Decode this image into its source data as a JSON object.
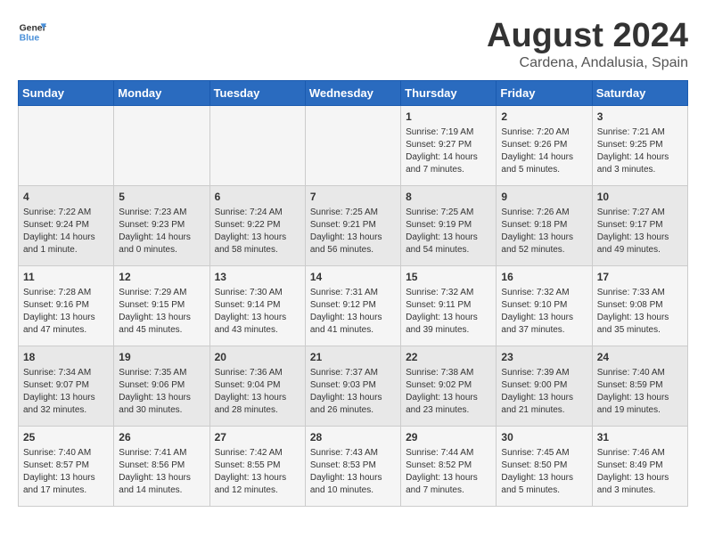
{
  "logo": {
    "line1": "General",
    "line2": "Blue"
  },
  "title": "August 2024",
  "subtitle": "Cardena, Andalusia, Spain",
  "weekdays": [
    "Sunday",
    "Monday",
    "Tuesday",
    "Wednesday",
    "Thursday",
    "Friday",
    "Saturday"
  ],
  "weeks": [
    [
      {
        "day": "",
        "info": ""
      },
      {
        "day": "",
        "info": ""
      },
      {
        "day": "",
        "info": ""
      },
      {
        "day": "",
        "info": ""
      },
      {
        "day": "1",
        "info": "Sunrise: 7:19 AM\nSunset: 9:27 PM\nDaylight: 14 hours\nand 7 minutes."
      },
      {
        "day": "2",
        "info": "Sunrise: 7:20 AM\nSunset: 9:26 PM\nDaylight: 14 hours\nand 5 minutes."
      },
      {
        "day": "3",
        "info": "Sunrise: 7:21 AM\nSunset: 9:25 PM\nDaylight: 14 hours\nand 3 minutes."
      }
    ],
    [
      {
        "day": "4",
        "info": "Sunrise: 7:22 AM\nSunset: 9:24 PM\nDaylight: 14 hours\nand 1 minute."
      },
      {
        "day": "5",
        "info": "Sunrise: 7:23 AM\nSunset: 9:23 PM\nDaylight: 14 hours\nand 0 minutes."
      },
      {
        "day": "6",
        "info": "Sunrise: 7:24 AM\nSunset: 9:22 PM\nDaylight: 13 hours\nand 58 minutes."
      },
      {
        "day": "7",
        "info": "Sunrise: 7:25 AM\nSunset: 9:21 PM\nDaylight: 13 hours\nand 56 minutes."
      },
      {
        "day": "8",
        "info": "Sunrise: 7:25 AM\nSunset: 9:19 PM\nDaylight: 13 hours\nand 54 minutes."
      },
      {
        "day": "9",
        "info": "Sunrise: 7:26 AM\nSunset: 9:18 PM\nDaylight: 13 hours\nand 52 minutes."
      },
      {
        "day": "10",
        "info": "Sunrise: 7:27 AM\nSunset: 9:17 PM\nDaylight: 13 hours\nand 49 minutes."
      }
    ],
    [
      {
        "day": "11",
        "info": "Sunrise: 7:28 AM\nSunset: 9:16 PM\nDaylight: 13 hours\nand 47 minutes."
      },
      {
        "day": "12",
        "info": "Sunrise: 7:29 AM\nSunset: 9:15 PM\nDaylight: 13 hours\nand 45 minutes."
      },
      {
        "day": "13",
        "info": "Sunrise: 7:30 AM\nSunset: 9:14 PM\nDaylight: 13 hours\nand 43 minutes."
      },
      {
        "day": "14",
        "info": "Sunrise: 7:31 AM\nSunset: 9:12 PM\nDaylight: 13 hours\nand 41 minutes."
      },
      {
        "day": "15",
        "info": "Sunrise: 7:32 AM\nSunset: 9:11 PM\nDaylight: 13 hours\nand 39 minutes."
      },
      {
        "day": "16",
        "info": "Sunrise: 7:32 AM\nSunset: 9:10 PM\nDaylight: 13 hours\nand 37 minutes."
      },
      {
        "day": "17",
        "info": "Sunrise: 7:33 AM\nSunset: 9:08 PM\nDaylight: 13 hours\nand 35 minutes."
      }
    ],
    [
      {
        "day": "18",
        "info": "Sunrise: 7:34 AM\nSunset: 9:07 PM\nDaylight: 13 hours\nand 32 minutes."
      },
      {
        "day": "19",
        "info": "Sunrise: 7:35 AM\nSunset: 9:06 PM\nDaylight: 13 hours\nand 30 minutes."
      },
      {
        "day": "20",
        "info": "Sunrise: 7:36 AM\nSunset: 9:04 PM\nDaylight: 13 hours\nand 28 minutes."
      },
      {
        "day": "21",
        "info": "Sunrise: 7:37 AM\nSunset: 9:03 PM\nDaylight: 13 hours\nand 26 minutes."
      },
      {
        "day": "22",
        "info": "Sunrise: 7:38 AM\nSunset: 9:02 PM\nDaylight: 13 hours\nand 23 minutes."
      },
      {
        "day": "23",
        "info": "Sunrise: 7:39 AM\nSunset: 9:00 PM\nDaylight: 13 hours\nand 21 minutes."
      },
      {
        "day": "24",
        "info": "Sunrise: 7:40 AM\nSunset: 8:59 PM\nDaylight: 13 hours\nand 19 minutes."
      }
    ],
    [
      {
        "day": "25",
        "info": "Sunrise: 7:40 AM\nSunset: 8:57 PM\nDaylight: 13 hours\nand 17 minutes."
      },
      {
        "day": "26",
        "info": "Sunrise: 7:41 AM\nSunset: 8:56 PM\nDaylight: 13 hours\nand 14 minutes."
      },
      {
        "day": "27",
        "info": "Sunrise: 7:42 AM\nSunset: 8:55 PM\nDaylight: 13 hours\nand 12 minutes."
      },
      {
        "day": "28",
        "info": "Sunrise: 7:43 AM\nSunset: 8:53 PM\nDaylight: 13 hours\nand 10 minutes."
      },
      {
        "day": "29",
        "info": "Sunrise: 7:44 AM\nSunset: 8:52 PM\nDaylight: 13 hours\nand 7 minutes."
      },
      {
        "day": "30",
        "info": "Sunrise: 7:45 AM\nSunset: 8:50 PM\nDaylight: 13 hours\nand 5 minutes."
      },
      {
        "day": "31",
        "info": "Sunrise: 7:46 AM\nSunset: 8:49 PM\nDaylight: 13 hours\nand 3 minutes."
      }
    ]
  ]
}
